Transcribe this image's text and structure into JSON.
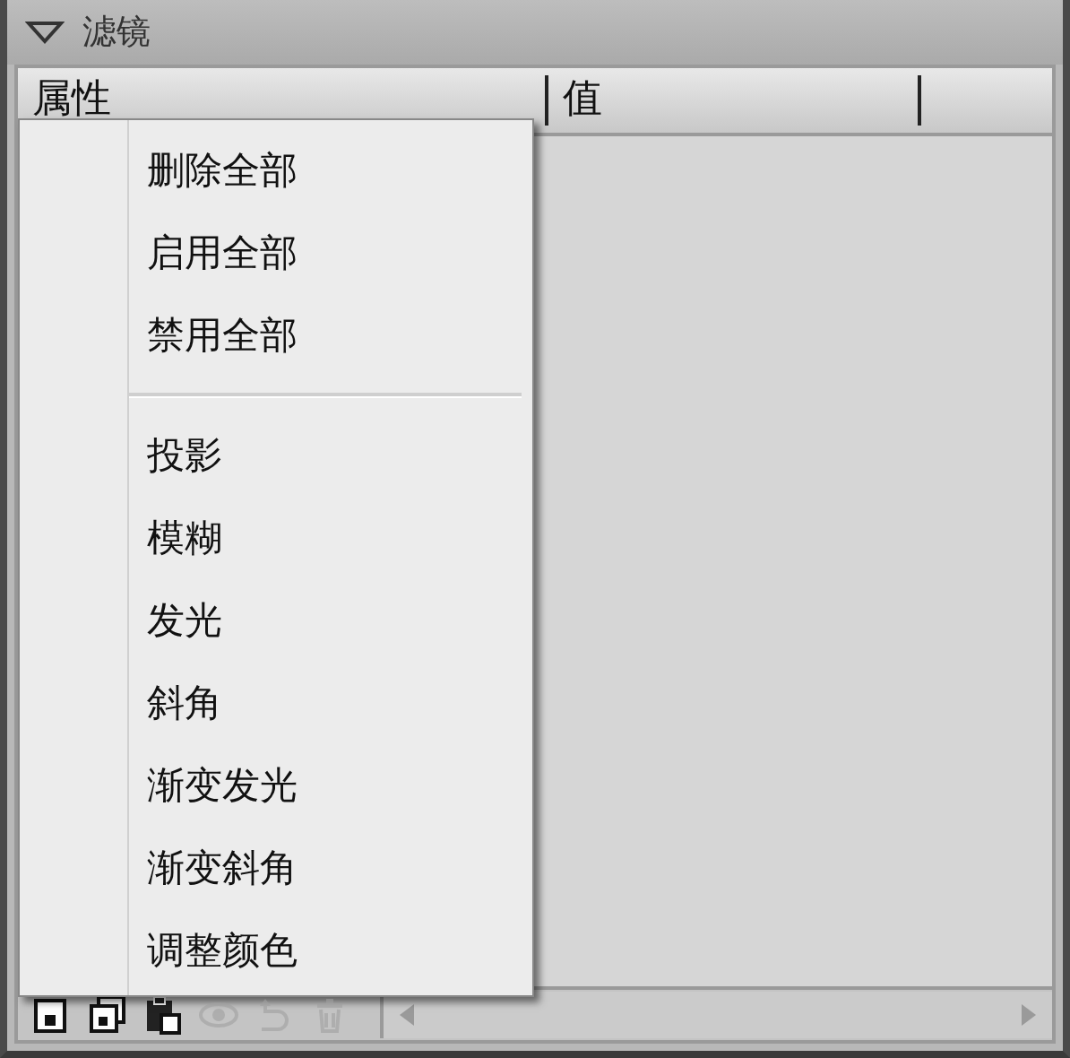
{
  "panel": {
    "title": "滤镜",
    "expanded": true
  },
  "table": {
    "columns": [
      "属性",
      "值"
    ]
  },
  "context_menu": {
    "groups": [
      [
        "删除全部",
        "启用全部",
        "禁用全部"
      ],
      [
        "投影",
        "模糊",
        "发光",
        "斜角",
        "渐变发光",
        "渐变斜角",
        "调整颜色"
      ]
    ]
  },
  "toolbar": [
    {
      "kind": "add",
      "disabled": false
    },
    {
      "kind": "duplicate",
      "disabled": false
    },
    {
      "kind": "paste",
      "disabled": false
    },
    {
      "kind": "visibility",
      "disabled": true
    },
    {
      "kind": "reset",
      "disabled": true
    },
    {
      "kind": "delete",
      "disabled": true
    }
  ]
}
